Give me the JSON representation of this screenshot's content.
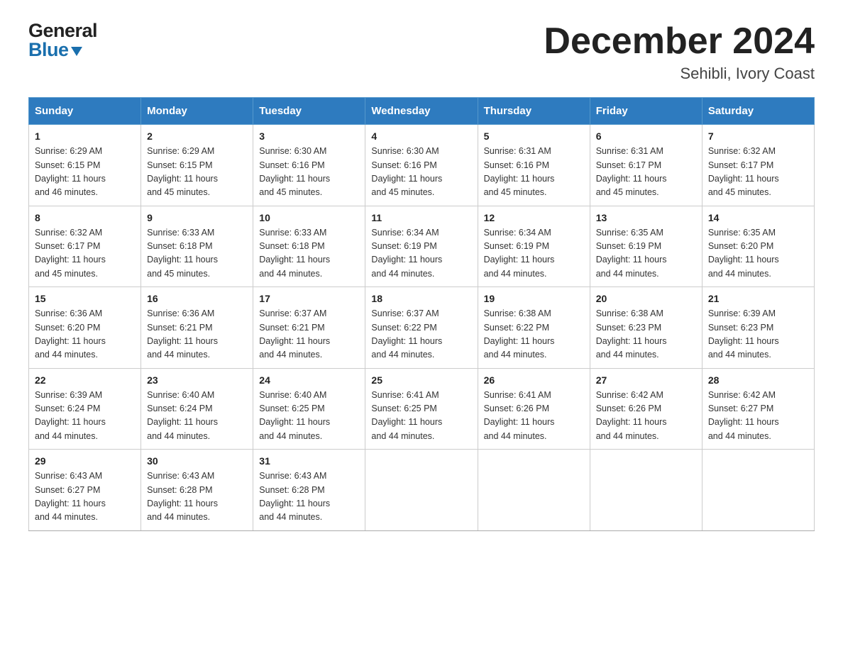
{
  "logo": {
    "line1": "General",
    "line2": "Blue"
  },
  "header": {
    "title": "December 2024",
    "subtitle": "Sehibli, Ivory Coast"
  },
  "weekdays": [
    "Sunday",
    "Monday",
    "Tuesday",
    "Wednesday",
    "Thursday",
    "Friday",
    "Saturday"
  ],
  "weeks": [
    [
      {
        "day": "1",
        "sunrise": "6:29 AM",
        "sunset": "6:15 PM",
        "daylight": "11 hours and 46 minutes."
      },
      {
        "day": "2",
        "sunrise": "6:29 AM",
        "sunset": "6:15 PM",
        "daylight": "11 hours and 45 minutes."
      },
      {
        "day": "3",
        "sunrise": "6:30 AM",
        "sunset": "6:16 PM",
        "daylight": "11 hours and 45 minutes."
      },
      {
        "day": "4",
        "sunrise": "6:30 AM",
        "sunset": "6:16 PM",
        "daylight": "11 hours and 45 minutes."
      },
      {
        "day": "5",
        "sunrise": "6:31 AM",
        "sunset": "6:16 PM",
        "daylight": "11 hours and 45 minutes."
      },
      {
        "day": "6",
        "sunrise": "6:31 AM",
        "sunset": "6:17 PM",
        "daylight": "11 hours and 45 minutes."
      },
      {
        "day": "7",
        "sunrise": "6:32 AM",
        "sunset": "6:17 PM",
        "daylight": "11 hours and 45 minutes."
      }
    ],
    [
      {
        "day": "8",
        "sunrise": "6:32 AM",
        "sunset": "6:17 PM",
        "daylight": "11 hours and 45 minutes."
      },
      {
        "day": "9",
        "sunrise": "6:33 AM",
        "sunset": "6:18 PM",
        "daylight": "11 hours and 45 minutes."
      },
      {
        "day": "10",
        "sunrise": "6:33 AM",
        "sunset": "6:18 PM",
        "daylight": "11 hours and 44 minutes."
      },
      {
        "day": "11",
        "sunrise": "6:34 AM",
        "sunset": "6:19 PM",
        "daylight": "11 hours and 44 minutes."
      },
      {
        "day": "12",
        "sunrise": "6:34 AM",
        "sunset": "6:19 PM",
        "daylight": "11 hours and 44 minutes."
      },
      {
        "day": "13",
        "sunrise": "6:35 AM",
        "sunset": "6:19 PM",
        "daylight": "11 hours and 44 minutes."
      },
      {
        "day": "14",
        "sunrise": "6:35 AM",
        "sunset": "6:20 PM",
        "daylight": "11 hours and 44 minutes."
      }
    ],
    [
      {
        "day": "15",
        "sunrise": "6:36 AM",
        "sunset": "6:20 PM",
        "daylight": "11 hours and 44 minutes."
      },
      {
        "day": "16",
        "sunrise": "6:36 AM",
        "sunset": "6:21 PM",
        "daylight": "11 hours and 44 minutes."
      },
      {
        "day": "17",
        "sunrise": "6:37 AM",
        "sunset": "6:21 PM",
        "daylight": "11 hours and 44 minutes."
      },
      {
        "day": "18",
        "sunrise": "6:37 AM",
        "sunset": "6:22 PM",
        "daylight": "11 hours and 44 minutes."
      },
      {
        "day": "19",
        "sunrise": "6:38 AM",
        "sunset": "6:22 PM",
        "daylight": "11 hours and 44 minutes."
      },
      {
        "day": "20",
        "sunrise": "6:38 AM",
        "sunset": "6:23 PM",
        "daylight": "11 hours and 44 minutes."
      },
      {
        "day": "21",
        "sunrise": "6:39 AM",
        "sunset": "6:23 PM",
        "daylight": "11 hours and 44 minutes."
      }
    ],
    [
      {
        "day": "22",
        "sunrise": "6:39 AM",
        "sunset": "6:24 PM",
        "daylight": "11 hours and 44 minutes."
      },
      {
        "day": "23",
        "sunrise": "6:40 AM",
        "sunset": "6:24 PM",
        "daylight": "11 hours and 44 minutes."
      },
      {
        "day": "24",
        "sunrise": "6:40 AM",
        "sunset": "6:25 PM",
        "daylight": "11 hours and 44 minutes."
      },
      {
        "day": "25",
        "sunrise": "6:41 AM",
        "sunset": "6:25 PM",
        "daylight": "11 hours and 44 minutes."
      },
      {
        "day": "26",
        "sunrise": "6:41 AM",
        "sunset": "6:26 PM",
        "daylight": "11 hours and 44 minutes."
      },
      {
        "day": "27",
        "sunrise": "6:42 AM",
        "sunset": "6:26 PM",
        "daylight": "11 hours and 44 minutes."
      },
      {
        "day": "28",
        "sunrise": "6:42 AM",
        "sunset": "6:27 PM",
        "daylight": "11 hours and 44 minutes."
      }
    ],
    [
      {
        "day": "29",
        "sunrise": "6:43 AM",
        "sunset": "6:27 PM",
        "daylight": "11 hours and 44 minutes."
      },
      {
        "day": "30",
        "sunrise": "6:43 AM",
        "sunset": "6:28 PM",
        "daylight": "11 hours and 44 minutes."
      },
      {
        "day": "31",
        "sunrise": "6:43 AM",
        "sunset": "6:28 PM",
        "daylight": "11 hours and 44 minutes."
      },
      null,
      null,
      null,
      null
    ]
  ],
  "labels": {
    "sunrise": "Sunrise:",
    "sunset": "Sunset:",
    "daylight": "Daylight:"
  }
}
